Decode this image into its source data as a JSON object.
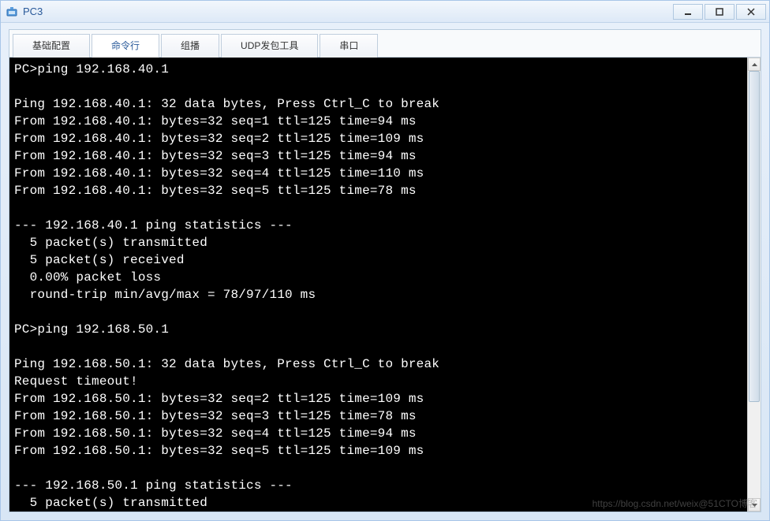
{
  "window": {
    "title": "PC3"
  },
  "tabs": [
    {
      "id": "basic",
      "label": "基础配置"
    },
    {
      "id": "cli",
      "label": "命令行"
    },
    {
      "id": "multicast",
      "label": "组播"
    },
    {
      "id": "udp",
      "label": "UDP发包工具"
    },
    {
      "id": "serial",
      "label": "串口"
    }
  ],
  "active_tab": "cli",
  "terminal": {
    "lines": [
      "PC>ping 192.168.40.1",
      "",
      "Ping 192.168.40.1: 32 data bytes, Press Ctrl_C to break",
      "From 192.168.40.1: bytes=32 seq=1 ttl=125 time=94 ms",
      "From 192.168.40.1: bytes=32 seq=2 ttl=125 time=109 ms",
      "From 192.168.40.1: bytes=32 seq=3 ttl=125 time=94 ms",
      "From 192.168.40.1: bytes=32 seq=4 ttl=125 time=110 ms",
      "From 192.168.40.1: bytes=32 seq=5 ttl=125 time=78 ms",
      "",
      "--- 192.168.40.1 ping statistics ---",
      "  5 packet(s) transmitted",
      "  5 packet(s) received",
      "  0.00% packet loss",
      "  round-trip min/avg/max = 78/97/110 ms",
      "",
      "PC>ping 192.168.50.1",
      "",
      "Ping 192.168.50.1: 32 data bytes, Press Ctrl_C to break",
      "Request timeout!",
      "From 192.168.50.1: bytes=32 seq=2 ttl=125 time=109 ms",
      "From 192.168.50.1: bytes=32 seq=3 ttl=125 time=78 ms",
      "From 192.168.50.1: bytes=32 seq=4 ttl=125 time=94 ms",
      "From 192.168.50.1: bytes=32 seq=5 ttl=125 time=109 ms",
      "",
      "--- 192.168.50.1 ping statistics ---",
      "  5 packet(s) transmitted"
    ]
  },
  "watermark": "https://blog.csdn.net/weix@51CTO博客"
}
